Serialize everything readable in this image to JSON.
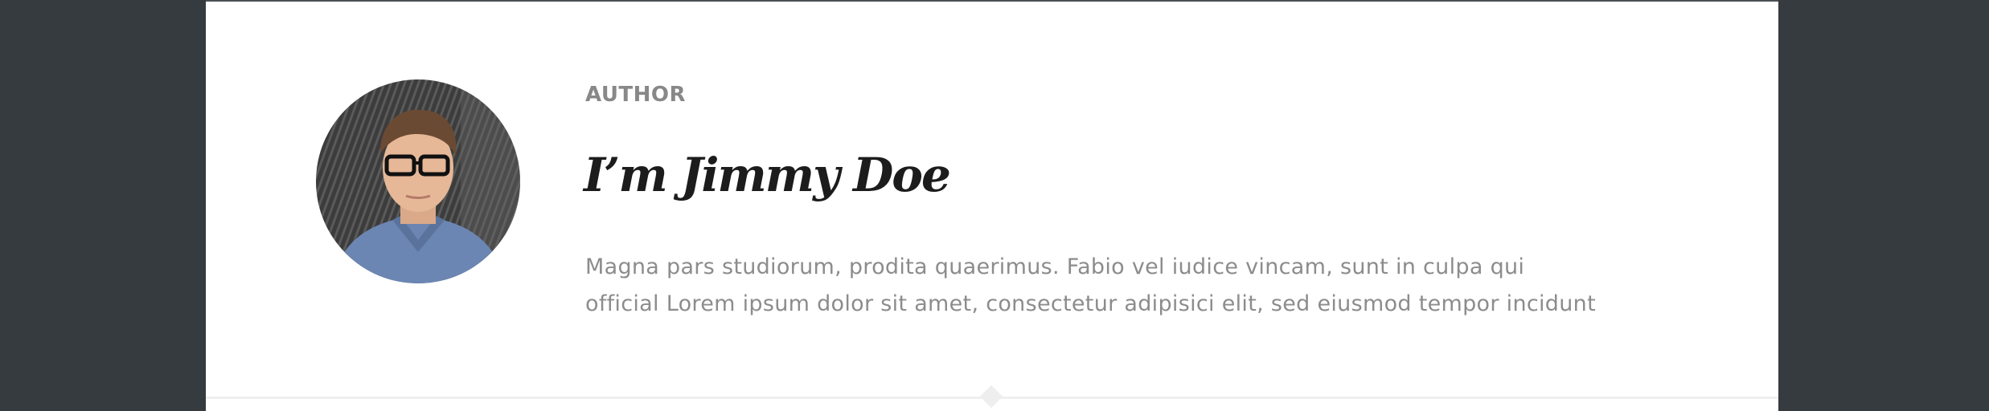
{
  "author_box": {
    "section_label": "AUTHOR",
    "name": "I’m Jimmy Doe",
    "bio_lines": [
      "Magna pars studiorum, prodita quaerimus. Fabio vel iudice vincam, sunt in culpa qui",
      "official Lorem ipsum dolor sit amet, consectetur adipisici elit, sed eiusmod tempor incidunt"
    ],
    "avatar_icon": "author-avatar-photo"
  },
  "colors": {
    "background": "#353b3f",
    "panel": "#ffffff",
    "label": "#888888",
    "name": "#1c1c1c",
    "bio": "#8c8c8c"
  }
}
